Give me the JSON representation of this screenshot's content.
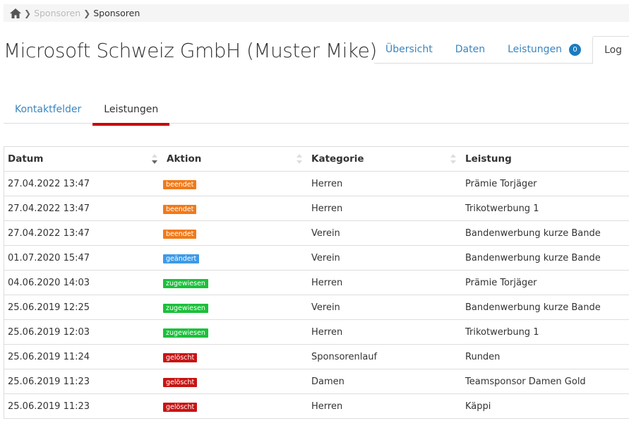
{
  "breadcrumb": {
    "items": [
      {
        "label": "Sponsoren"
      },
      {
        "label": "Sponsoren"
      }
    ]
  },
  "title": "Microsoft Schweiz GmbH (Muster Mike)",
  "top_tabs": [
    {
      "label": "Übersicht"
    },
    {
      "label": "Daten"
    },
    {
      "label": "Leistungen",
      "badge": "0"
    },
    {
      "label": "Log"
    }
  ],
  "sub_tabs": [
    {
      "label": "Kontaktfelder"
    },
    {
      "label": "Leistungen"
    }
  ],
  "table": {
    "columns": [
      "Datum",
      "Aktion",
      "Kategorie",
      "Leistung"
    ],
    "rows": [
      {
        "datum": "27.04.2022 13:47",
        "aktion": "beendet",
        "kategorie": "Herren",
        "leistung": "Prämie Torjäger"
      },
      {
        "datum": "27.04.2022 13:47",
        "aktion": "beendet",
        "kategorie": "Herren",
        "leistung": "Trikotwerbung 1"
      },
      {
        "datum": "27.04.2022 13:47",
        "aktion": "beendet",
        "kategorie": "Verein",
        "leistung": "Bandenwerbung kurze Bande"
      },
      {
        "datum": "01.07.2020 15:47",
        "aktion": "geändert",
        "kategorie": "Verein",
        "leistung": "Bandenwerbung kurze Bande"
      },
      {
        "datum": "04.06.2020 14:03",
        "aktion": "zugewiesen",
        "kategorie": "Herren",
        "leistung": "Prämie Torjäger"
      },
      {
        "datum": "25.06.2019 12:25",
        "aktion": "zugewiesen",
        "kategorie": "Verein",
        "leistung": "Bandenwerbung kurze Bande"
      },
      {
        "datum": "25.06.2019 12:03",
        "aktion": "zugewiesen",
        "kategorie": "Herren",
        "leistung": "Trikotwerbung 1"
      },
      {
        "datum": "25.06.2019 11:24",
        "aktion": "gelöscht",
        "kategorie": "Sponsorenlauf",
        "leistung": "Runden"
      },
      {
        "datum": "25.06.2019 11:23",
        "aktion": "gelöscht",
        "kategorie": "Damen",
        "leistung": "Teamsponsor Damen Gold"
      },
      {
        "datum": "25.06.2019 11:23",
        "aktion": "gelöscht",
        "kategorie": "Herren",
        "leistung": "Käppi"
      }
    ]
  },
  "action_colors": {
    "beendet": "#f07a1a",
    "geändert": "#3d9ae8",
    "zugewiesen": "#1bc03a",
    "gelöscht": "#c81414"
  }
}
